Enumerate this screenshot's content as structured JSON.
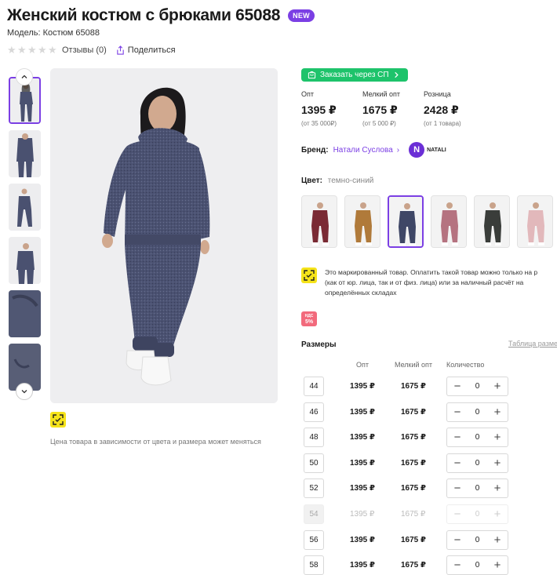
{
  "product": {
    "title": "Женский костюм с брюками 65088",
    "badge": "NEW",
    "model": "Модель: Костюм 65088",
    "reviews": "Отзывы (0)",
    "share": "Поделиться",
    "rating": 0,
    "rating_max": 5,
    "price_note": "Цена товара в зависимости от цвета и размера может меняться"
  },
  "sp_button": "Заказать через СП",
  "prices": [
    {
      "label": "Опт",
      "value": "1395 ₽",
      "sub": "(от 35 000₽)"
    },
    {
      "label": "Мелкий опт",
      "value": "1675 ₽",
      "sub": "(от 5 000 ₽)"
    },
    {
      "label": "Розница",
      "value": "2428 ₽",
      "sub": "(от 1 товара)"
    }
  ],
  "brand": {
    "label": "Бренд:",
    "name": "Натали Суслова",
    "logo_letter": "N",
    "logo_text": "NATALI"
  },
  "color": {
    "label": "Цвет:",
    "value": "темно-синий",
    "swatches": [
      {
        "name": "бордовый",
        "hex": "#7a2a34"
      },
      {
        "name": "горчичный",
        "hex": "#b07a3a"
      },
      {
        "name": "темно-синий",
        "hex": "#3f4766",
        "selected": true
      },
      {
        "name": "пыльно-розовый",
        "hex": "#b57380"
      },
      {
        "name": "графит",
        "hex": "#3a3d3a"
      },
      {
        "name": "розовый",
        "hex": "#e2b8bb"
      }
    ]
  },
  "marking": {
    "text": "Это маркированный товар. Оплатить такой товар можно только на р\n(как от юр. лица, так и от физ. лица) или за наличный расчёт на\nопределённых складах"
  },
  "vat": {
    "top": "НДС",
    "bottom": "5%"
  },
  "sizes": {
    "title": "Размеры",
    "table_link": "Таблица разме",
    "col_opt": "Опт",
    "col_small": "Мелкий опт",
    "col_qty": "Количество",
    "rows": [
      {
        "size": "44",
        "opt": "1395 ₽",
        "small": "1675 ₽",
        "qty": "0",
        "minus": "−",
        "plus": "+"
      },
      {
        "size": "46",
        "opt": "1395 ₽",
        "small": "1675 ₽",
        "qty": "0",
        "minus": "−",
        "plus": "+"
      },
      {
        "size": "48",
        "opt": "1395 ₽",
        "small": "1675 ₽",
        "qty": "0",
        "minus": "−",
        "plus": "+"
      },
      {
        "size": "50",
        "opt": "1395 ₽",
        "small": "1675 ₽",
        "qty": "0",
        "minus": "−",
        "plus": "+"
      },
      {
        "size": "52",
        "opt": "1395 ₽",
        "small": "1675 ₽",
        "qty": "0",
        "minus": "−",
        "plus": "+"
      },
      {
        "size": "54",
        "opt": "1395 ₽",
        "small": "1675 ₽",
        "qty": "0",
        "minus": "−",
        "plus": "+",
        "disabled": true
      },
      {
        "size": "56",
        "opt": "1395 ₽",
        "small": "1675 ₽",
        "qty": "0",
        "minus": "−",
        "plus": "+"
      },
      {
        "size": "58",
        "opt": "1395 ₽",
        "small": "1675 ₽",
        "qty": "0",
        "minus": "−",
        "plus": "+"
      }
    ]
  },
  "colors": {
    "accent": "#7b3fe4",
    "green": "#1ec36b",
    "suit": "#4a5170",
    "marking_yellow": "#f5e31a"
  }
}
